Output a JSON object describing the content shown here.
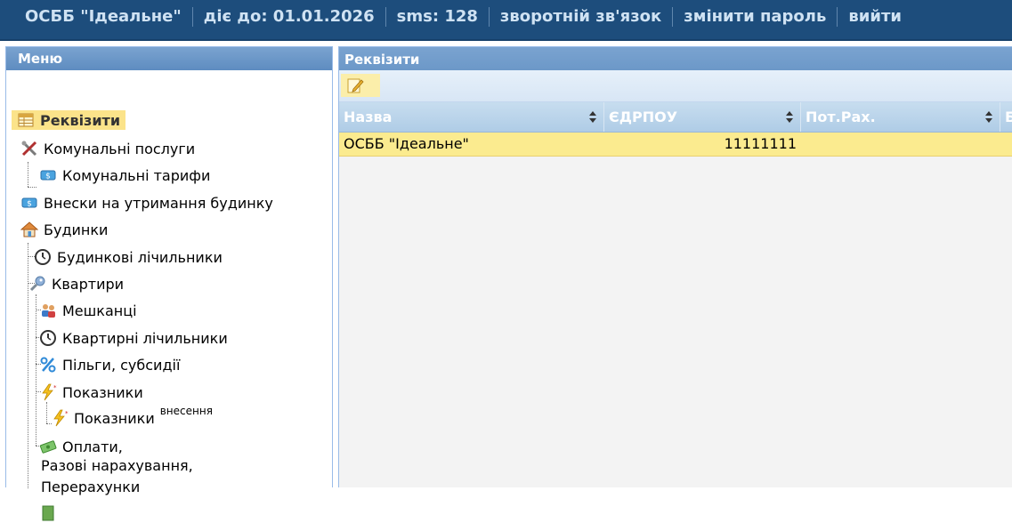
{
  "topbar": {
    "org_name": "ОСББ \"Ідеальне\"",
    "valid_until": "діє до: 01.01.2026",
    "sms": "sms: 128",
    "feedback": "зворотній зв'язок",
    "change_password": "змінити пароль",
    "logout": "вийти"
  },
  "menu": {
    "title": "Меню",
    "items": {
      "requisites": "Реквізити",
      "utilities": "Комунальні послуги",
      "utility_tariffs": "Комунальні тарифи",
      "maintenance_fees": "Внески на утримання будинку",
      "buildings": "Будинки",
      "building_meters": "Будинкові лічильники",
      "apartments": "Квартири",
      "residents": "Мешканці",
      "apartment_meters": "Квартирні лічильники",
      "benefits": "Пільги, субсидії",
      "readings": "Показники",
      "readings_entry": "Показники",
      "readings_entry_sup": "внесення",
      "payments_line1": "Оплати,",
      "payments_line2": "Разові нарахування,",
      "payments_line3": "Перерахунки"
    }
  },
  "content": {
    "title": "Реквізити",
    "columns": [
      "Назва",
      "ЄДРПОУ",
      "Пот.Рах.",
      "Б"
    ],
    "rows": [
      {
        "name": "ОСББ \"Ідеальне\"",
        "edrpou": "11111111",
        "account": "",
        "extra": ""
      }
    ]
  },
  "colors": {
    "topbar_bg": "#1d4d7c",
    "highlight": "#fbe38a",
    "selected_row": "#fbeb8f",
    "panel_header": "#6c98c8"
  },
  "icons": {
    "requisites": "table-icon",
    "utilities": "tools-icon",
    "tariffs": "money-tag-icon",
    "buildings": "house-icon",
    "meters": "clock-icon",
    "apartments": "key-icon",
    "residents": "people-icon",
    "benefits": "percent-icon",
    "readings": "lightning-icon",
    "payments": "money-icon",
    "edit": "edit-icon"
  }
}
